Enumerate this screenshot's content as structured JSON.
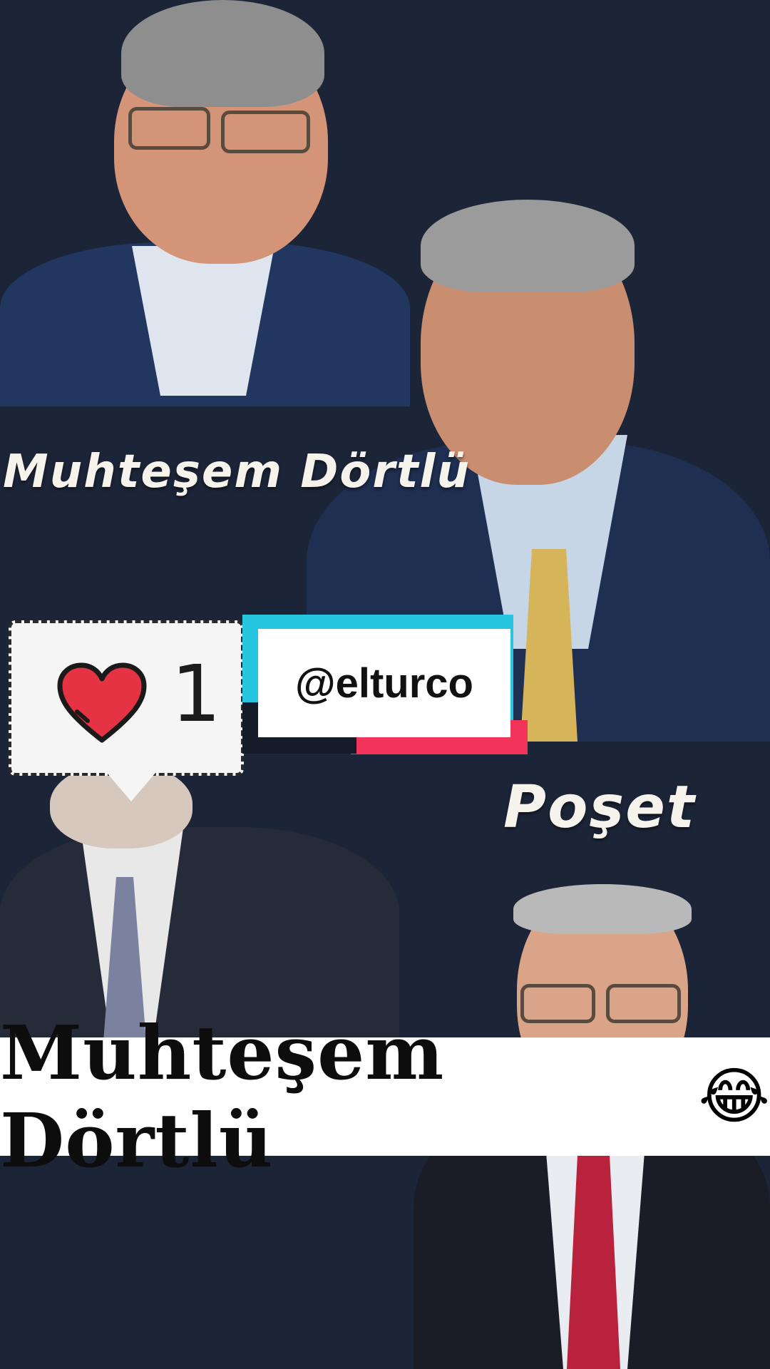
{
  "stickers": {
    "top_caption": "Muhteşem Dörtlü",
    "middle_caption": "Poşet"
  },
  "like_bubble": {
    "icon": "heart-icon",
    "count": "1"
  },
  "username_tag": {
    "text": "@elturco"
  },
  "main_caption": {
    "text": "Muhteşem Dörtlü",
    "emoji": "😂"
  },
  "colors": {
    "background": "#1c2538",
    "tag_cyan": "#27c6e0",
    "tag_red": "#f2345b",
    "heart": "#e53343"
  }
}
